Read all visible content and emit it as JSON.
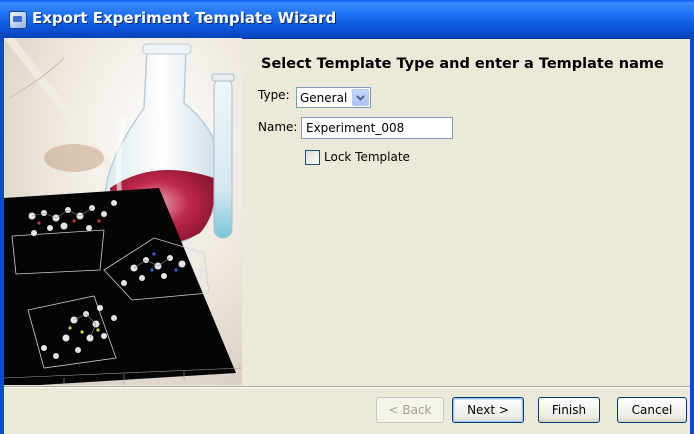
{
  "window": {
    "title": "Export Experiment Template Wizard"
  },
  "form": {
    "heading": "Select Template Type and enter a Template name",
    "type_label": "Type:",
    "type_value": "General",
    "name_label": "Name:",
    "name_value": "Experiment_008",
    "lock_label": "Lock Template",
    "lock_checked": false
  },
  "buttons": {
    "back": "< Back",
    "next": "Next >",
    "finish": "Finish",
    "cancel": "Cancel"
  },
  "icons": [
    "app-icon",
    "chevron-down-icon"
  ],
  "colors": {
    "titlebar": "#0a54d6",
    "window_bg": "#ece9d8",
    "flask_liquid": "#c0284a"
  }
}
